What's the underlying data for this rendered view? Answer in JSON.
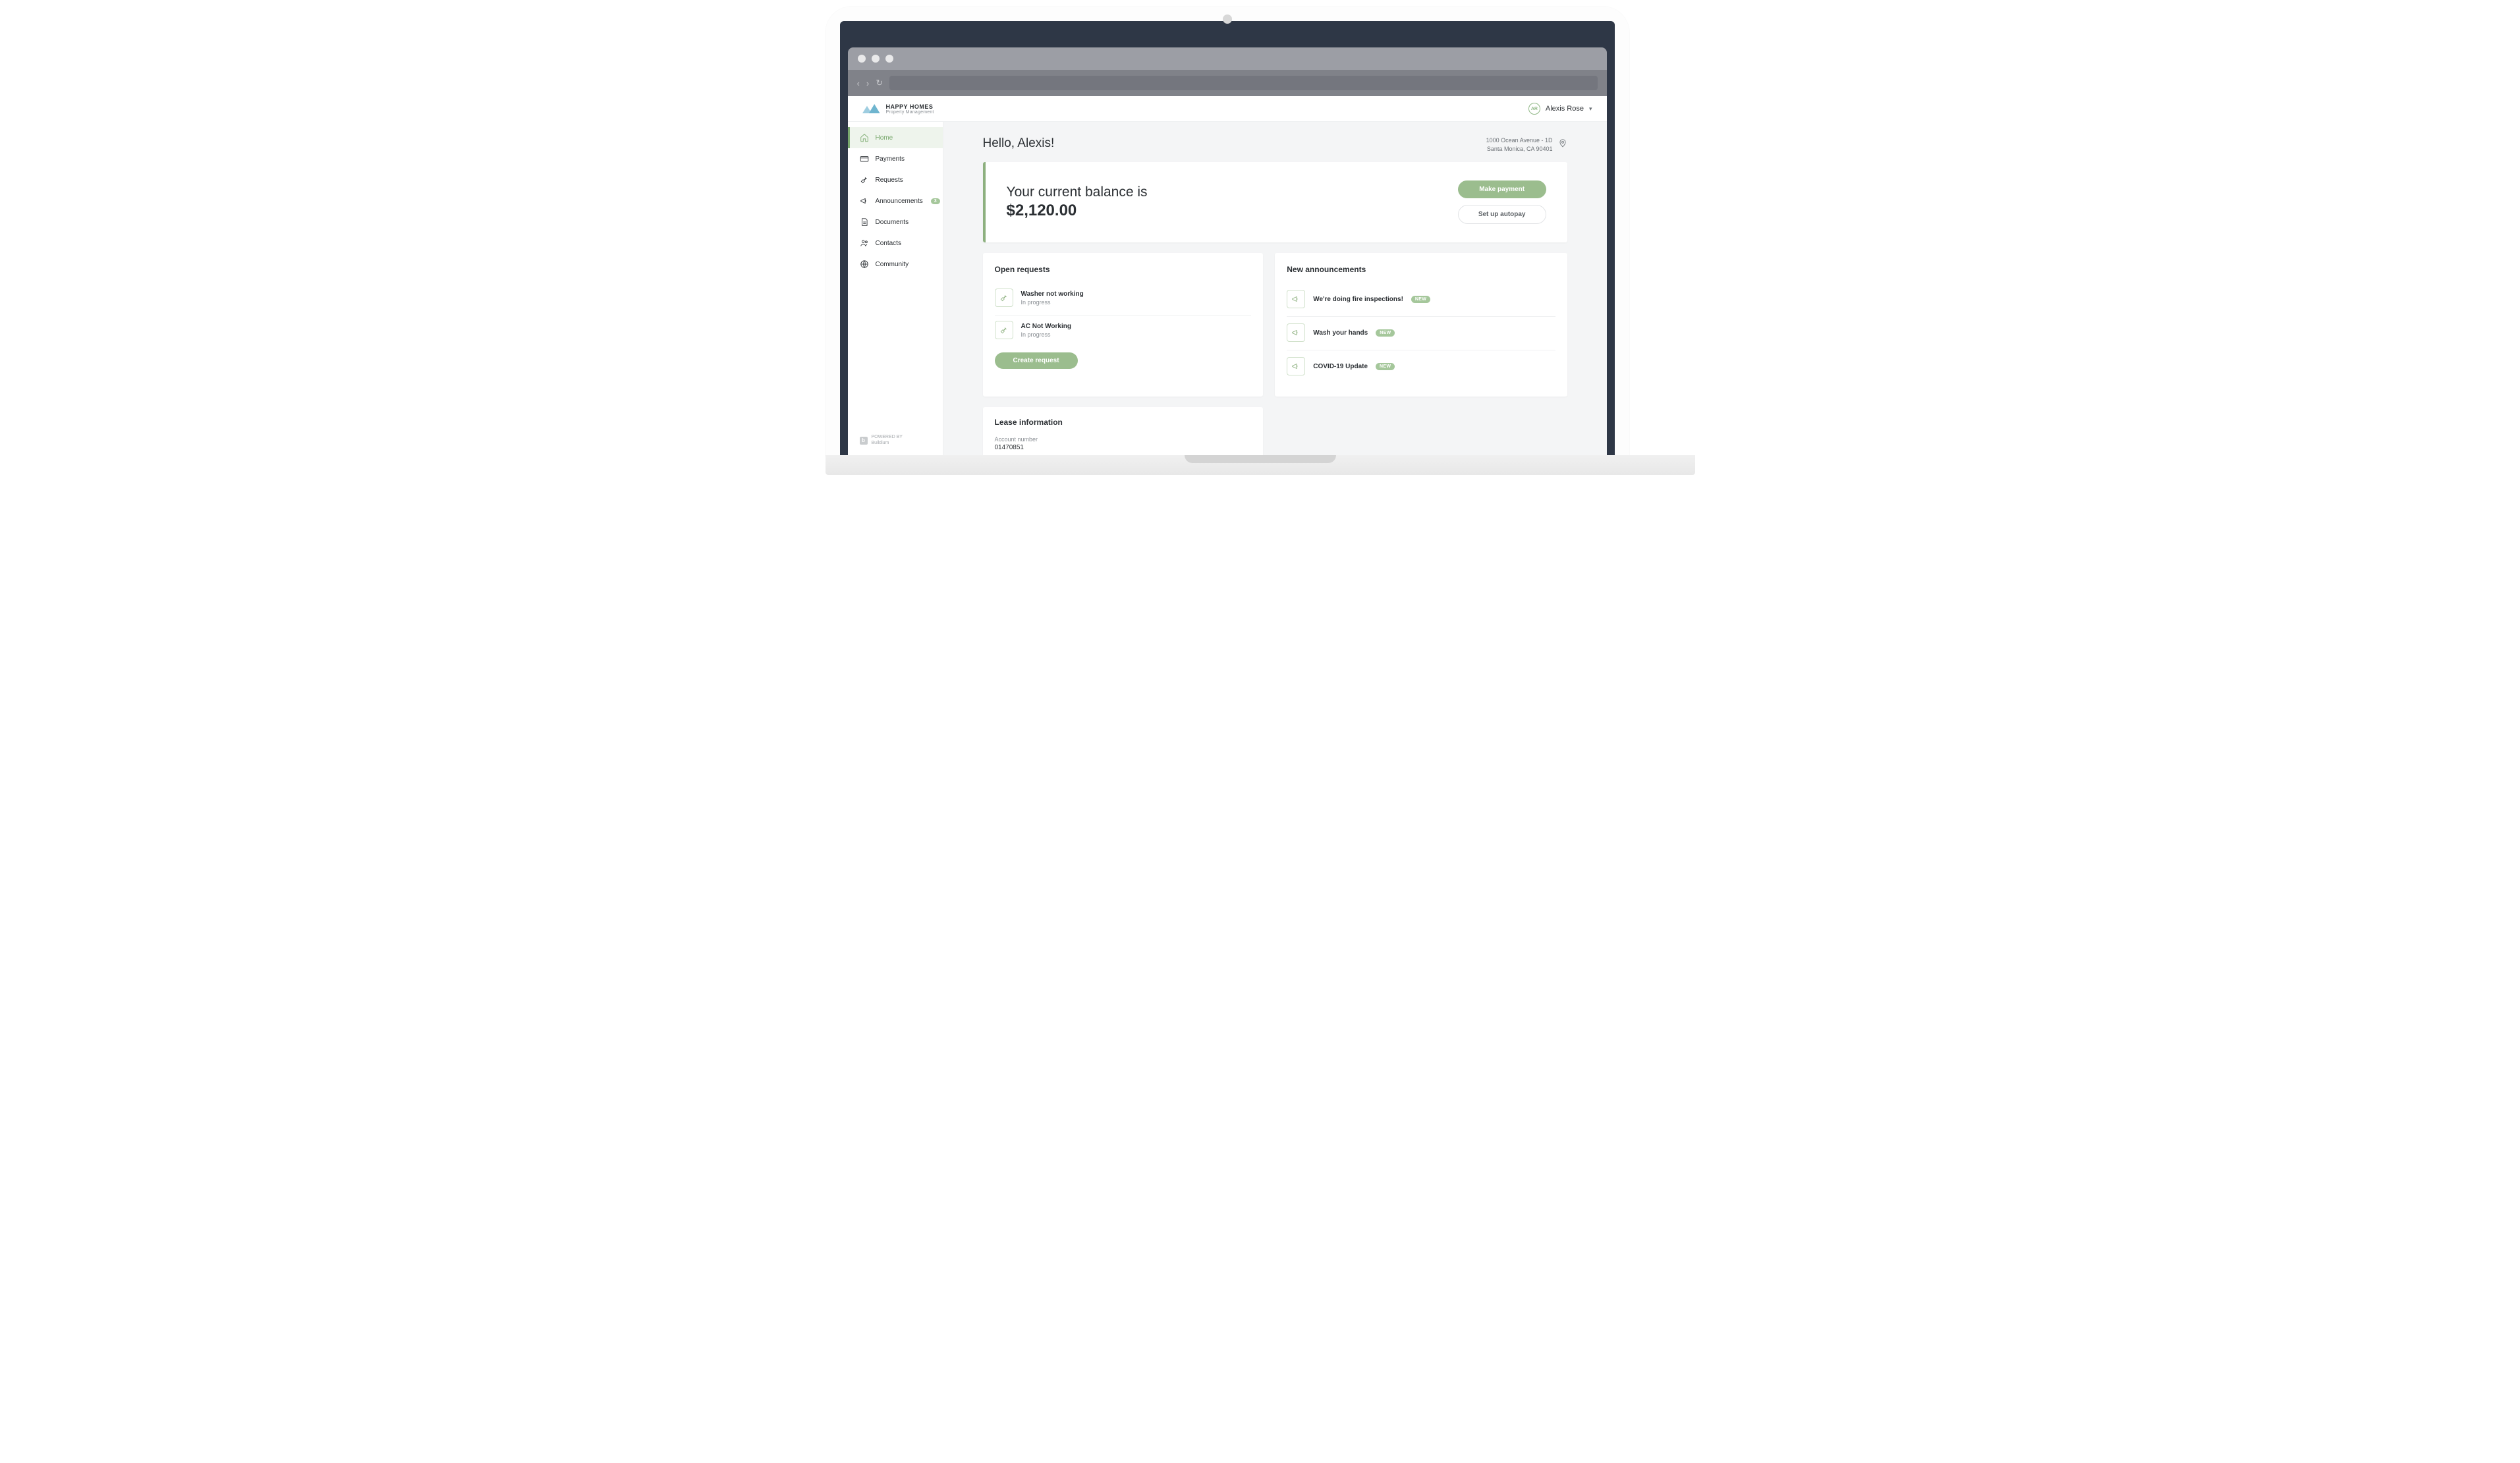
{
  "brand": {
    "name": "HAPPY HOMES",
    "subtitle": "Property Management"
  },
  "user": {
    "initials": "AR",
    "name": "Alexis Rose"
  },
  "sidebar": {
    "items": [
      {
        "label": "Home"
      },
      {
        "label": "Payments"
      },
      {
        "label": "Requests"
      },
      {
        "label": "Announcements",
        "badge": "3"
      },
      {
        "label": "Documents"
      },
      {
        "label": "Contacts"
      },
      {
        "label": "Community"
      }
    ],
    "powered_label": "POWERED BY",
    "powered_name": "Buildium"
  },
  "greeting": "Hello, Alexis!",
  "address": {
    "line1": "1000 Ocean Avenue - 1D",
    "line2": "Santa Monica, CA 90401"
  },
  "balance": {
    "label": "Your current balance is",
    "amount": "$2,120.00",
    "make_payment": "Make payment",
    "autopay": "Set up autopay"
  },
  "requests": {
    "title": "Open requests",
    "items": [
      {
        "title": "Washer not working",
        "status": "In progress"
      },
      {
        "title": "AC Not Working",
        "status": "In progress"
      }
    ],
    "create": "Create request"
  },
  "announcements": {
    "title": "New announcements",
    "items": [
      {
        "title": "We're doing fire inspections!",
        "badge": "NEW"
      },
      {
        "title": "Wash your hands",
        "badge": "NEW"
      },
      {
        "title": "COVID-19 Update",
        "badge": "NEW"
      }
    ]
  },
  "lease": {
    "title": "Lease information",
    "account_label": "Account number",
    "account_value": "01470851"
  }
}
